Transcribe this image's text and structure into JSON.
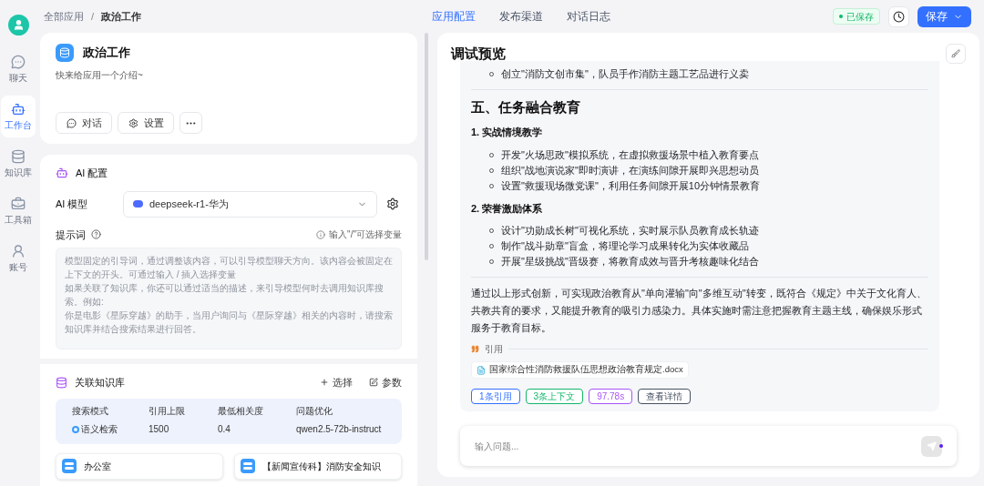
{
  "sidebar": {
    "items": [
      {
        "label": "聊天",
        "selected": false
      },
      {
        "label": "工作台",
        "selected": true
      },
      {
        "label": "知识库",
        "selected": false
      },
      {
        "label": "工具箱",
        "selected": false
      },
      {
        "label": "账号",
        "selected": false
      }
    ]
  },
  "breadcrumb": [
    "全部应用",
    "政治工作"
  ],
  "breadcrumb_separator": "/",
  "tabs": [
    {
      "label": "应用配置",
      "selected": true
    },
    {
      "label": "发布渠道",
      "selected": false
    },
    {
      "label": "对话日志",
      "selected": false
    }
  ],
  "header": {
    "saved_badge": "已保存",
    "save_button": "保存"
  },
  "app_card": {
    "title": "政治工作",
    "intro": "快来给应用一个介绍~",
    "buttons": [
      "对话",
      "设置"
    ]
  },
  "ai_config": {
    "title": "AI 配置",
    "model_label": "AI 模型",
    "model": "deepseek-r1-华为",
    "prompt_label": "提示词",
    "prompt_hint": "输入\"/\"可选择变量",
    "prompt_placeholder": [
      "模型固定的引导词，通过调整该内容，可以引导模型聊天方向。该内容会被固定在上下文的开头。可通过输入 / 插入选择变量",
      "如果关联了知识库，你还可以通过适当的描述，来引导模型何时去调用知识库搜索。例如:",
      "你是电影《星际穿越》的助手，当用户询问与《星际穿越》相关的内容时，请搜索知识库并结合搜索结果进行回答。"
    ]
  },
  "knowledge": {
    "title": "关联知识库",
    "actions": [
      "选择",
      "参数"
    ],
    "table": {
      "columns": [
        "搜索模式",
        "引用上限",
        "最低相关度",
        "问题优化"
      ],
      "row": [
        "语义检索",
        "1500",
        "0.4",
        "qwen2.5-72b-instruct"
      ]
    },
    "datasets": [
      "办公室",
      "【新闻宣传科】消防安全知识"
    ]
  },
  "preview": {
    "title": "调试预览",
    "blocks": [
      {
        "kind": "bullet",
        "text": "创立\"消防文创市集\"，队员手作消防主题工艺品进行义卖"
      },
      {
        "kind": "divider"
      },
      {
        "kind": "heading",
        "text": "五、任务融合教育"
      },
      {
        "kind": "subheading",
        "text": "1. 实战情境教学"
      },
      {
        "kind": "bullet",
        "text": "开发\"火场思政\"模拟系统，在虚拟救援场景中植入教育要点"
      },
      {
        "kind": "bullet",
        "text": "组织\"战地演说家\"即时演讲，在演练间隙开展即兴思想动员"
      },
      {
        "kind": "bullet",
        "text": "设置\"救援现场微党课\"，利用任务间隙开展10分钟情景教育"
      },
      {
        "kind": "subheading",
        "text": "2. 荣誉激励体系"
      },
      {
        "kind": "bullet",
        "text": "设计\"功勋成长树\"可视化系统，实时展示队员教育成长轨迹"
      },
      {
        "kind": "bullet",
        "text": "制作\"战斗勋章\"盲盒，将理论学习成果转化为实体收藏品"
      },
      {
        "kind": "bullet",
        "text": "开展\"星级挑战\"晋级赛，将教育成效与晋升考核趣味化结合"
      },
      {
        "kind": "divider"
      },
      {
        "kind": "paragraph",
        "text": "通过以上形式创新，可实现政治教育从\"单向灌输\"向\"多维互动\"转变，既符合《规定》中关于文化育人、共教共育的要求，又能提升教育的吸引力感染力。具体实施时需注意把握教育主题主线，确保娱乐形式服务于教育目标。"
      }
    ],
    "citation_label": "引用",
    "citation_file": "国家综合性消防救援队伍思想政治教育规定.docx",
    "tags": [
      {
        "label": "1条引用",
        "color": "#3370ff"
      },
      {
        "label": "3条上下文",
        "color": "#12b76a"
      },
      {
        "label": "97.78s",
        "color": "#a855f7"
      },
      {
        "label": "查看详情",
        "color": "#485264"
      }
    ],
    "input_placeholder": "输入问题..."
  }
}
